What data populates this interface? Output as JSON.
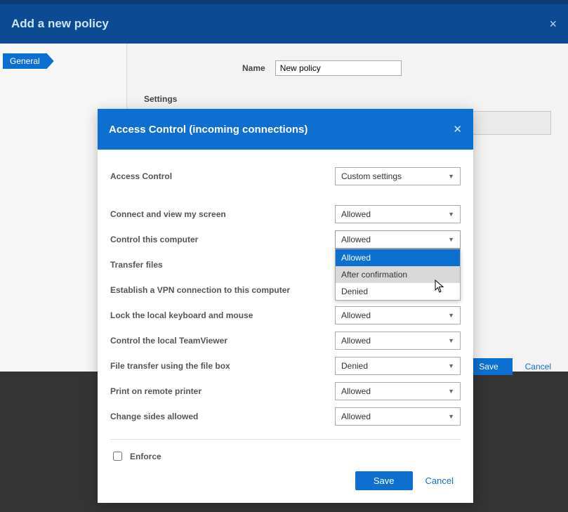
{
  "outer": {
    "title": "Add a new policy",
    "sidebar_tab": "General",
    "name_label": "Name",
    "name_value": "New policy",
    "settings_heading": "Settings",
    "save_label": "Save",
    "cancel_label": "Cancel"
  },
  "modal": {
    "title": "Access Control (incoming connections)",
    "save_label": "Save",
    "cancel_label": "Cancel",
    "enforce_label": "Enforce",
    "enforce_checked": false,
    "rows": {
      "access_control": {
        "label": "Access Control",
        "value": "Custom settings"
      },
      "connect_view": {
        "label": "Connect and view my screen",
        "value": "Allowed"
      },
      "control_computer": {
        "label": "Control this computer",
        "value": "Allowed"
      },
      "transfer_files": {
        "label": "Transfer files",
        "value": ""
      },
      "vpn": {
        "label": "Establish a VPN connection to this computer",
        "value": ""
      },
      "lock_kb": {
        "label": "Lock the local keyboard and mouse",
        "value": "Allowed"
      },
      "control_tv": {
        "label": "Control the local TeamViewer",
        "value": "Allowed"
      },
      "file_box": {
        "label": "File transfer using the file box",
        "value": "Denied"
      },
      "print": {
        "label": "Print on remote printer",
        "value": "Allowed"
      },
      "change_sides": {
        "label": "Change sides allowed",
        "value": "Allowed"
      }
    },
    "dropdown_options": {
      "opt0": "Allowed",
      "opt1": "After confirmation",
      "opt2": "Denied"
    }
  }
}
